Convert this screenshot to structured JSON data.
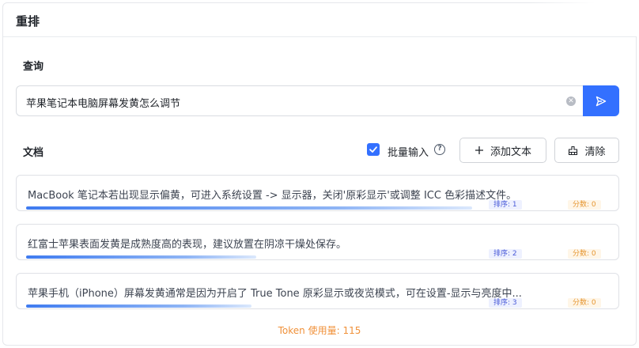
{
  "header": {
    "title": "重排"
  },
  "query": {
    "label": "查询",
    "value": "苹果笔记本电脑屏幕发黄怎么调节"
  },
  "documents": {
    "label": "文档",
    "batch_input_label": "批量输入",
    "batch_input_checked": true,
    "add_text_label": "添加文本",
    "clear_label": "清除",
    "items": [
      {
        "text": "MacBook 笔记本若出现显示偏黄，可进入系统设置 -> 显示器，关闭'原彩显示'或调整 ICC 色彩描述文件。",
        "rank": "排序: 1",
        "score": "分数: 0",
        "bar_fraction": 0.91
      },
      {
        "text": "红富士苹果表面发黄是成熟度高的表现，建议放置在阴凉干燥处保存。",
        "rank": "排序: 2",
        "score": "分数: 0",
        "bar_fraction": 0.47
      },
      {
        "text": "苹果手机（iPhone）屏幕发黄通常是因为开启了 True Tone 原彩显示或夜览模式，可在设置-显示与亮度中...",
        "rank": "排序: 3",
        "score": "分数: 0",
        "bar_fraction": 0.46
      }
    ]
  },
  "footer": {
    "token_usage": "Token 使用量: 115"
  },
  "colors": {
    "primary": "#3370ff",
    "rank_text": "#4a5bd8",
    "score_text": "#e5952f",
    "token_text": "#f0913a"
  }
}
